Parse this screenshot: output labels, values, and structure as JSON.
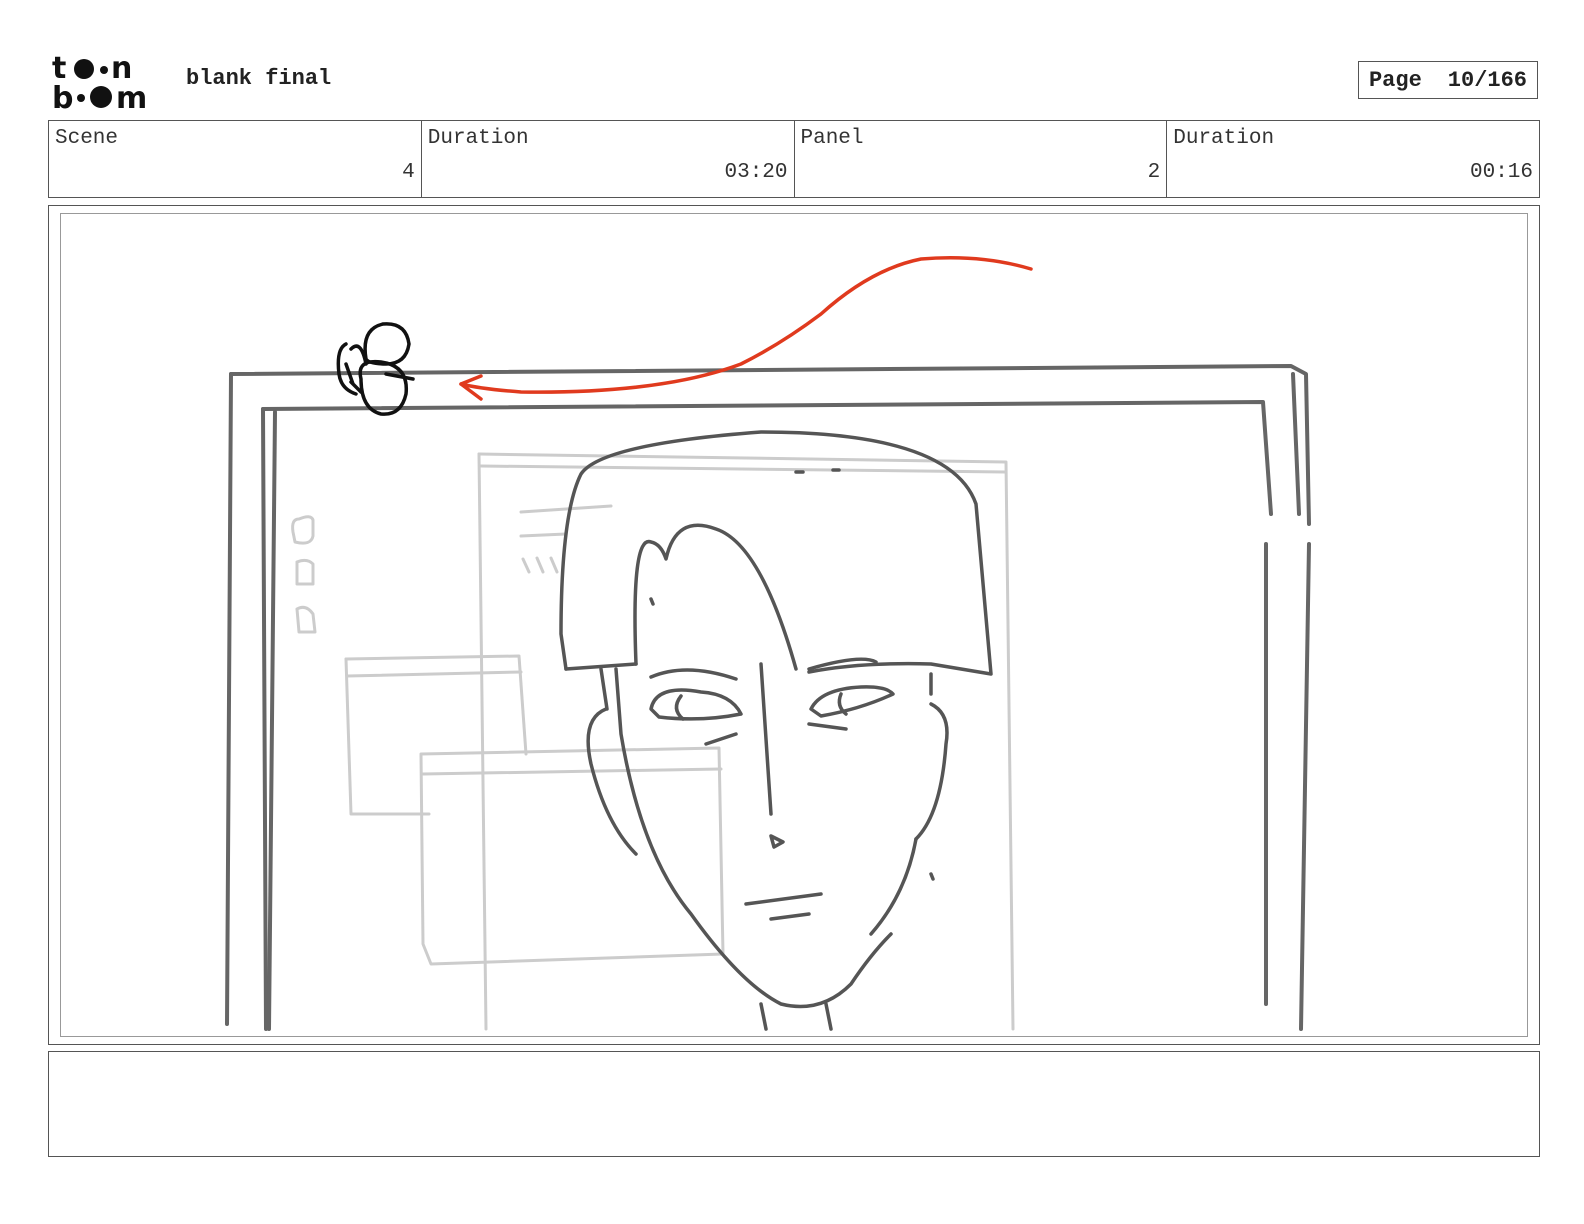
{
  "header": {
    "logo_alt": "toon boom",
    "project_title": "blank final",
    "page_label": "Page",
    "page_value": "10/166"
  },
  "info": {
    "scene_label": "Scene",
    "scene_value": "4",
    "scene_duration_label": "Duration",
    "scene_duration_value": "03:20",
    "panel_label": "Panel",
    "panel_value": "2",
    "panel_duration_label": "Duration",
    "panel_duration_value": "00:16"
  },
  "notes": {
    "text": ""
  },
  "colors": {
    "sketch": "#666666",
    "light_sketch": "#cccccc",
    "arrow": "#e03a1e",
    "ink": "#111111"
  }
}
